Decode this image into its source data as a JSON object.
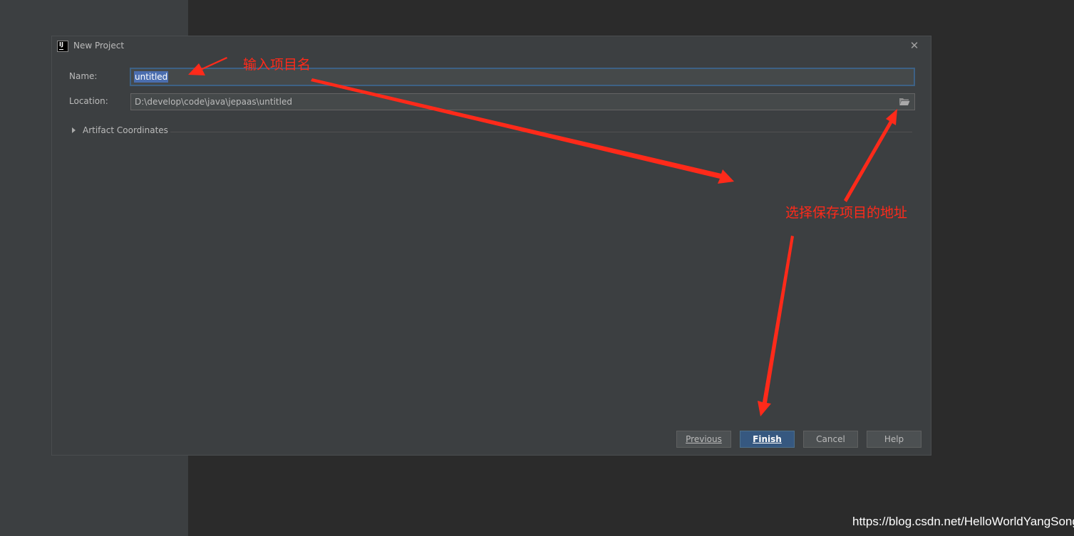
{
  "dialog": {
    "title": "New Project",
    "close_glyph": "✕",
    "app_icon_text": "IJ"
  },
  "form": {
    "name_label": "Name:",
    "name_value": "untitled",
    "location_label": "Location:",
    "location_value": "D:\\develop\\code\\java\\jepaas\\untitled",
    "folder_icon": "folder-icon",
    "artifact_label": "Artifact Coordinates"
  },
  "buttons": {
    "previous": "Previous",
    "finish": "Finish",
    "cancel": "Cancel",
    "help": "Help"
  },
  "annotations": {
    "name_hint": "输入项目名",
    "location_hint": "选择保存项目的地址",
    "color": "#ff2a1a"
  },
  "watermark": "https://blog.csdn.net/HelloWorldYangSong",
  "colors": {
    "dialog_bg": "#3c3f41",
    "primary_button": "#365880",
    "selection": "#4b6eaf"
  }
}
